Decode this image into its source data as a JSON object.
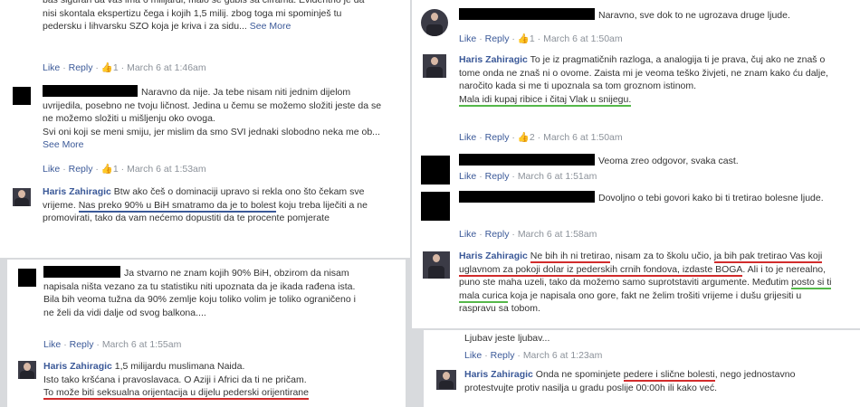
{
  "colors": {
    "link": "#3b5998",
    "meta": "#8c929a",
    "redact": "#000000",
    "underline_red": "#d12b2b",
    "underline_green": "#55b84a"
  },
  "p1": {
    "c0": {
      "text": "baš siguran da vas ima 6 milijardi, malo se gubiš sa ciframa. Evidentno je da nisi skontala ekspertizu čega i kojih 1,5 milij. zbog toga mi spominješ tu pedersku i lihvarsku SZO koja je kriva i za sidu...",
      "see_more": "See More",
      "like": "Like",
      "reply": "Reply",
      "likes": "1",
      "time": "March 6 at 1:46am"
    },
    "c1": {
      "text": "Naravno da nije. Ja tebe nisam niti jednim dijelom uvrijedila, posebno ne tvoju ličnost. Jedina u čemu se možemo složiti jeste da se ne možemo složiti u mišljenju oko ovoga.",
      "text2": "Svi oni koji se meni smiju, jer mislim da smo SVI jednaki slobodno neka me ob...",
      "see_more": "See More",
      "like": "Like",
      "reply": "Reply",
      "likes": "1",
      "time": "March 6 at 1:53am"
    },
    "c2": {
      "name": "Haris Zahiragic",
      "text_a": "Btw ako češ o dominaciji upravo si rekla ono što čekam sve vrijeme. ",
      "text_u": "Nas preko 90% u BiH smatramo da je to bolest",
      "text_b": " koju treba liječiti a ne promovirati, tako da vam nećemo dopustiti da te procente pomjerate"
    }
  },
  "p2": {
    "c0": {
      "text": "Ja stvarno ne znam kojih 90% BiH, obzirom da nisam napisala ništa vezano za tu statistiku niti upoznata da je ikada rađena ista.",
      "text2": "Bila bih veoma tužna da 90% zemlje koju toliko volim je toliko ograničeno i ne želi da vidi dalje od svog balkona....",
      "like": "Like",
      "reply": "Reply",
      "time": "March 6 at 1:55am"
    },
    "c1": {
      "name": "Haris Zahiragic",
      "text": "1,5 milijardu muslimana Naida.",
      "text2": "Isto tako kršćana i pravoslavaca. O Aziji i Africi da ti ne pričam.",
      "text3": "To može biti seksualna orijentacija u dijelu pederski orijentirane"
    }
  },
  "p3": {
    "c0": {
      "text": "Naravno, sve dok to ne ugrozava druge ljude.",
      "like": "Like",
      "reply": "Reply",
      "likes": "1",
      "time": "March 6 at 1:50am"
    },
    "c1": {
      "name": "Haris Zahiragic",
      "text": "To je iz pragmatičnih razloga, a analogija ti je prava, čuj ako ne znaš o tome onda ne znaš ni o ovome. Zaista mi je veoma teško živjeti, ne znam kako ću dalje, naročito kada si me ti upoznala sa tom groznom istinom.",
      "text_u": "Mala idi kupaj ribice i čitaj Vlak u snijegu.",
      "like": "Like",
      "reply": "Reply",
      "likes": "2",
      "time": "March 6 at 1:50am"
    },
    "c2": {
      "text": "Veoma zreo odgovor, svaka cast.",
      "like": "Like",
      "reply": "Reply",
      "time": "March 6 at 1:51am"
    },
    "c3": {
      "text": "Dovoljno o tebi govori kako bi ti tretirao bolesne ljude.",
      "like": "Like",
      "reply": "Reply",
      "time": "March 6 at 1:58am"
    },
    "c4": {
      "name": "Haris Zahiragic",
      "u1": "Ne bih ih ni tretirao",
      "t1": ", nisam za to školu učio, ",
      "u2": "ja bih pak tretirao Vas koji uglavnom za pokoji dolar iz pederskih crnih fondova, izdaste BOGA",
      "t2": ". Ali i to je nerealno, puno ste maha uzeli, tako da možemo samo suprotstaviti argumente. Međutim ",
      "u3": "posto si ti mala curica",
      "t3": " koja je napisala ono gore, fakt ne želim trošiti vrijeme i dušu grijesiti u raspravu sa tobom."
    }
  },
  "p4": {
    "c0": {
      "text": "Ljubav jeste ljubav...",
      "like": "Like",
      "reply": "Reply",
      "time": "March 6 at 1:23am"
    },
    "c1": {
      "name": "Haris Zahiragic",
      "t1": "Onda ne spominjete ",
      "u1": "pedere i slične bolesti",
      "t2": ", nego jednostavno protestvujte protiv nasilja u gradu poslije 00:00h ili kako već."
    }
  }
}
